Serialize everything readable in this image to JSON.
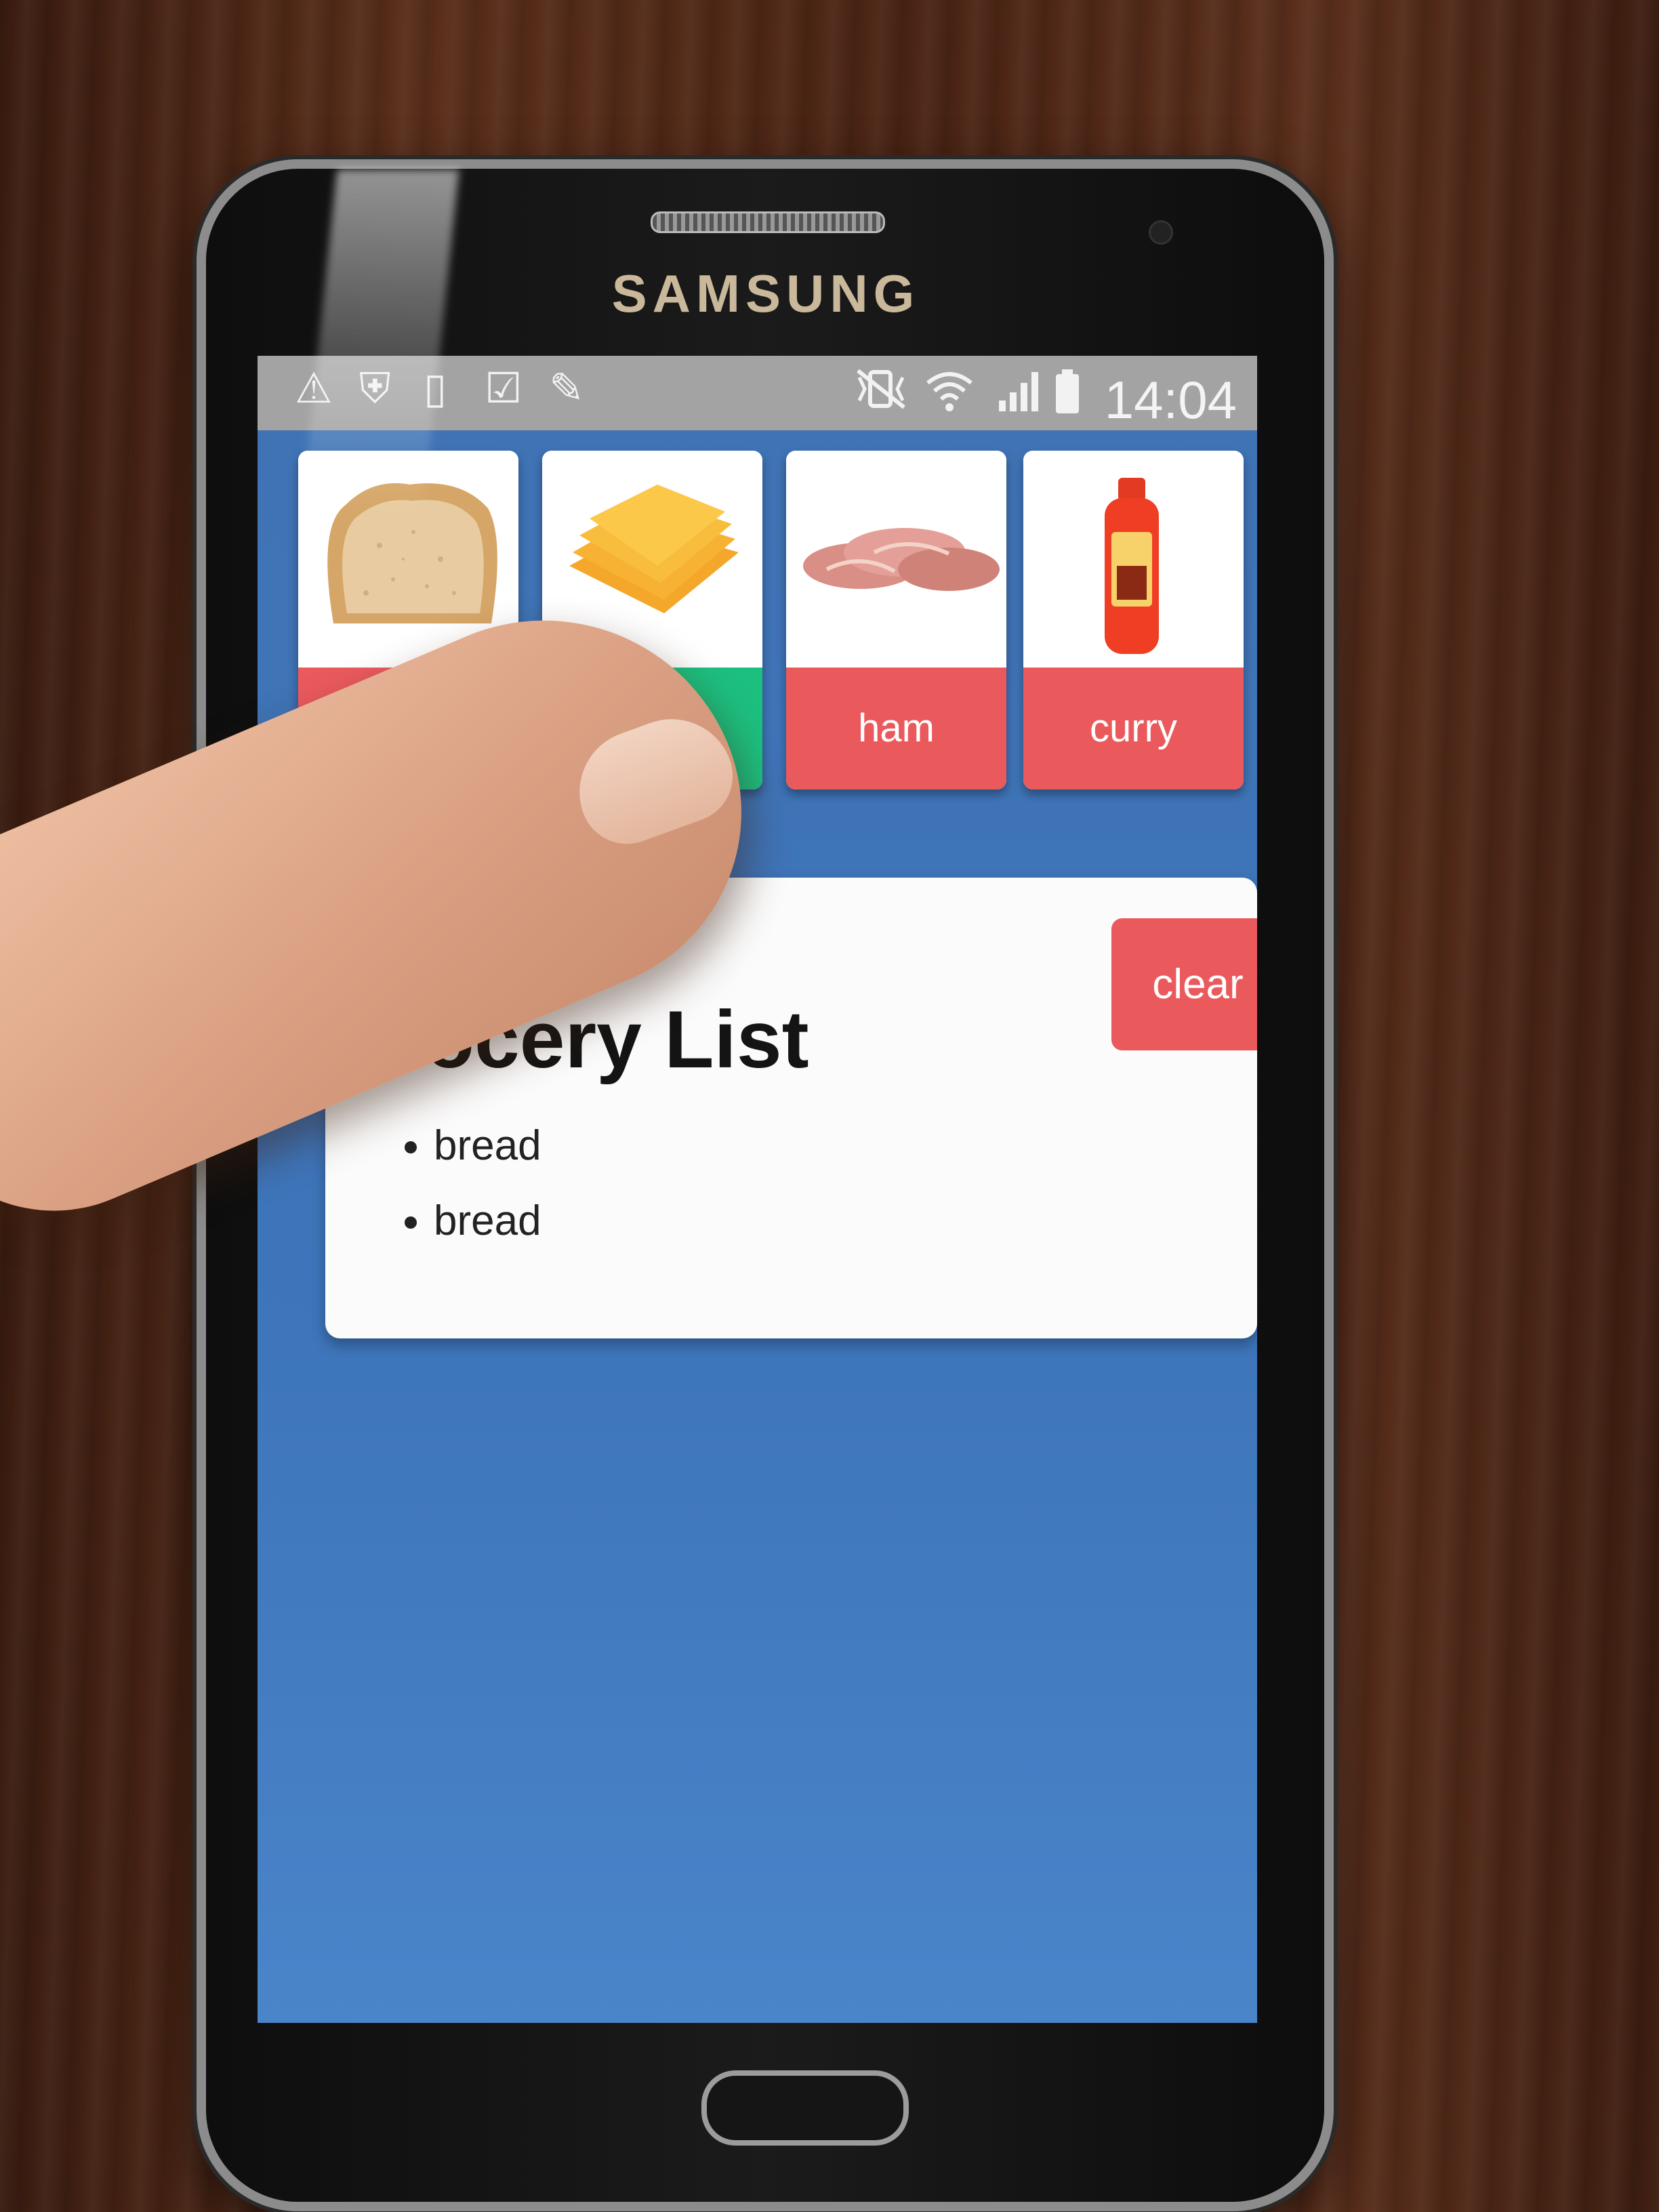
{
  "device": {
    "brand": "SAMSUNG"
  },
  "status_bar": {
    "time": "14:04",
    "left_icons": [
      "warning-icon",
      "shield-icon",
      "sim-icon",
      "clipboard-check-icon",
      "pencil-icon"
    ],
    "right_icons": [
      "mute-vibrate-icon",
      "wifi-icon",
      "signal-icon",
      "battery-icon"
    ]
  },
  "items": [
    {
      "label": "bread",
      "image": "bread-icon",
      "selected": false
    },
    {
      "label": "",
      "image": "cheese-icon",
      "selected": true
    },
    {
      "label": "ham",
      "image": "ham-icon",
      "selected": false
    },
    {
      "label": "curry",
      "image": "curry-bottle-icon",
      "selected": false
    }
  ],
  "grocery": {
    "title": "rocery List",
    "clear_label": "clear",
    "list": [
      "bread",
      "bread"
    ]
  },
  "colors": {
    "card_label": "#ea5a5d",
    "card_label_selected": "#1dbf7f",
    "screen_bg": "#3f73b4",
    "status_bar": "#a3a3a3"
  }
}
